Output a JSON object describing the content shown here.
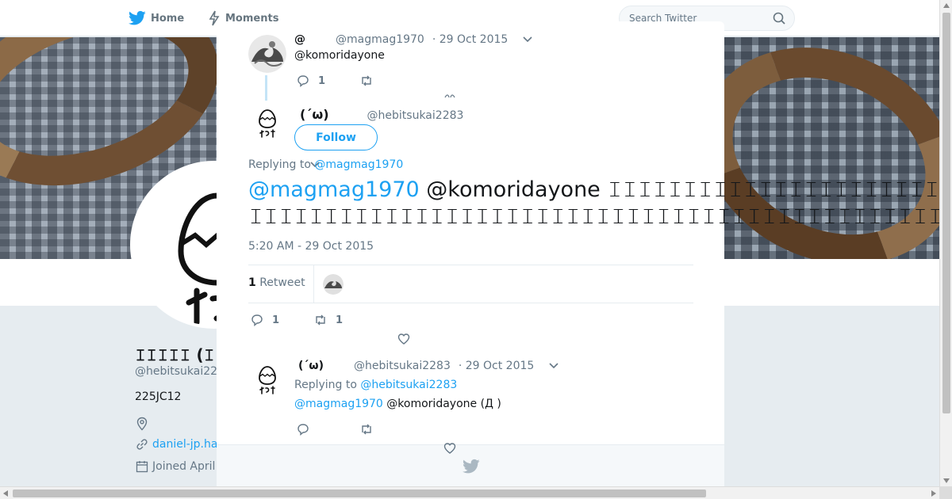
{
  "nav": {
    "home_label": "Home",
    "moments_label": "Moments",
    "search_placeholder": "Search Twitter"
  },
  "profile": {
    "name": "𝙸𝙸𝙸𝙸𝙸 (𝙸´𝙸",
    "handle": "@hebitsukai22",
    "bio": "225JC12",
    "link": "daniel-jp.ha",
    "joined": "Joined April"
  },
  "thread": {
    "parent": {
      "name": "@",
      "handle": "@magmag1970",
      "date": "· 29 Oct 2015",
      "text": "@komoridayone",
      "reply_count": "1",
      "retweet_count": ""
    },
    "main": {
      "name": "(´ω)",
      "handle": "@hebitsukai2283",
      "follow_label": "Follow",
      "replying_prefix": "Replying to",
      "replying_to": "@magmag1970",
      "text_mention": "@magmag1970",
      "text_line1_rest": " @komoridayone 𝙸𝙸𝙸𝙸𝙸𝙸𝙸𝙸𝙸𝙸𝙸𝙸𝙸𝙸𝙸𝙸𝙸𝙸𝙸𝙸𝙸𝙸𝙸𝙸𝙸𝙸𝙸𝙸",
      "text_line2": "𝙸𝙸𝙸𝙸𝙸𝙸𝙸𝙸𝙸𝙸𝙸𝙸𝙸𝙸𝙸𝙸𝙸𝙸𝙸𝙸𝙸𝙸𝙸𝙸𝙸𝙸𝙸𝙸𝙸𝙸𝙸𝙸𝙸𝙸𝙸𝙸𝙸𝙸𝙸𝙸𝙸𝙸𝙸𝙸𝙸𝙸𝙸",
      "timestamp": "5:20 AM - 29 Oct 2015",
      "retweets_number": "1",
      "retweets_label": "Retweet",
      "reply_count": "1",
      "retweet_count": "1"
    },
    "reply": {
      "name": "(´ω)",
      "handle": "@hebitsukai2283",
      "date": "· 29 Oct 2015",
      "replying_prefix": "Replying to",
      "replying_to": "@hebitsukai2283",
      "text_mention": "@magmag1970",
      "text_rest": " @komoridayone (Д )"
    }
  },
  "colors": {
    "accent": "#1da1f2",
    "muted": "#657786",
    "text": "#14171a"
  }
}
